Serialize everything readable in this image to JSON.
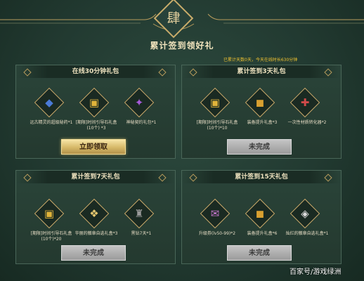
{
  "emblem_char": "肆",
  "main_title": "累计签到领好礼",
  "status_text": "已累计天数0天，今天在线时长630分钟",
  "colors": {
    "accent_gold": "#c9ac6a",
    "status_yellow": "#f0c230",
    "background": "#223a31"
  },
  "panels": [
    {
      "title": "在线30分钟礼包",
      "items": [
        {
          "icon": "blue-gem-pack-icon",
          "glyph": "◆",
          "color": "#4a7ad6",
          "label": "远古精灵的超级秘药*1"
        },
        {
          "icon": "golden-box-icon",
          "glyph": "▣",
          "color": "#e0b33a",
          "label": "[期限]时间引导石礼盒 (10个) *3"
        },
        {
          "icon": "purple-contract-icon",
          "glyph": "✦",
          "color": "#a65ad9",
          "label": "神秘契约礼包*1"
        }
      ],
      "button": "立即领取",
      "button_state": "claim"
    },
    {
      "title": "累计签到3天礼包",
      "items": [
        {
          "icon": "golden-box-icon",
          "glyph": "▣",
          "color": "#e0b33a",
          "label": "[期限]时间引导石礼盒 (10个)*10"
        },
        {
          "icon": "gold-chest-icon",
          "glyph": "◼",
          "color": "#d9a030",
          "label": "装备提升礼盒*3"
        },
        {
          "icon": "red-potion-icon",
          "glyph": "✚",
          "color": "#d04a4a",
          "label": "一次性材质转化器*2"
        }
      ],
      "button": "未完成",
      "button_state": "disabled"
    },
    {
      "title": "累计签到7天礼包",
      "items": [
        {
          "icon": "golden-box-icon",
          "glyph": "▣",
          "color": "#e0b33a",
          "label": "[期限]时间引导石礼盒 (10个)*20"
        },
        {
          "icon": "emblem-box-icon",
          "glyph": "❖",
          "color": "#e5c870",
          "label": "华丽的徽章自选礼盒*3"
        },
        {
          "icon": "dark-armor-icon",
          "glyph": "♜",
          "color": "#9a9a9a",
          "label": "黑钻7天*1"
        }
      ],
      "button": "未完成",
      "button_state": "disabled"
    },
    {
      "title": "累计签到15天礼包",
      "items": [
        {
          "icon": "upgrade-ticket-icon",
          "glyph": "✉",
          "color": "#c878d0",
          "label": "升级券(lv50-99)*2"
        },
        {
          "icon": "gold-chest-icon",
          "glyph": "◼",
          "color": "#d9a030",
          "label": "装备提升礼盒*6"
        },
        {
          "icon": "silver-emblem-icon",
          "glyph": "◈",
          "color": "#dcdcdc",
          "label": "灿烂的徽章自选礼盒*1"
        }
      ],
      "button": "未完成",
      "button_state": "disabled"
    }
  ],
  "watermark": "百家号/游戏绿洲"
}
